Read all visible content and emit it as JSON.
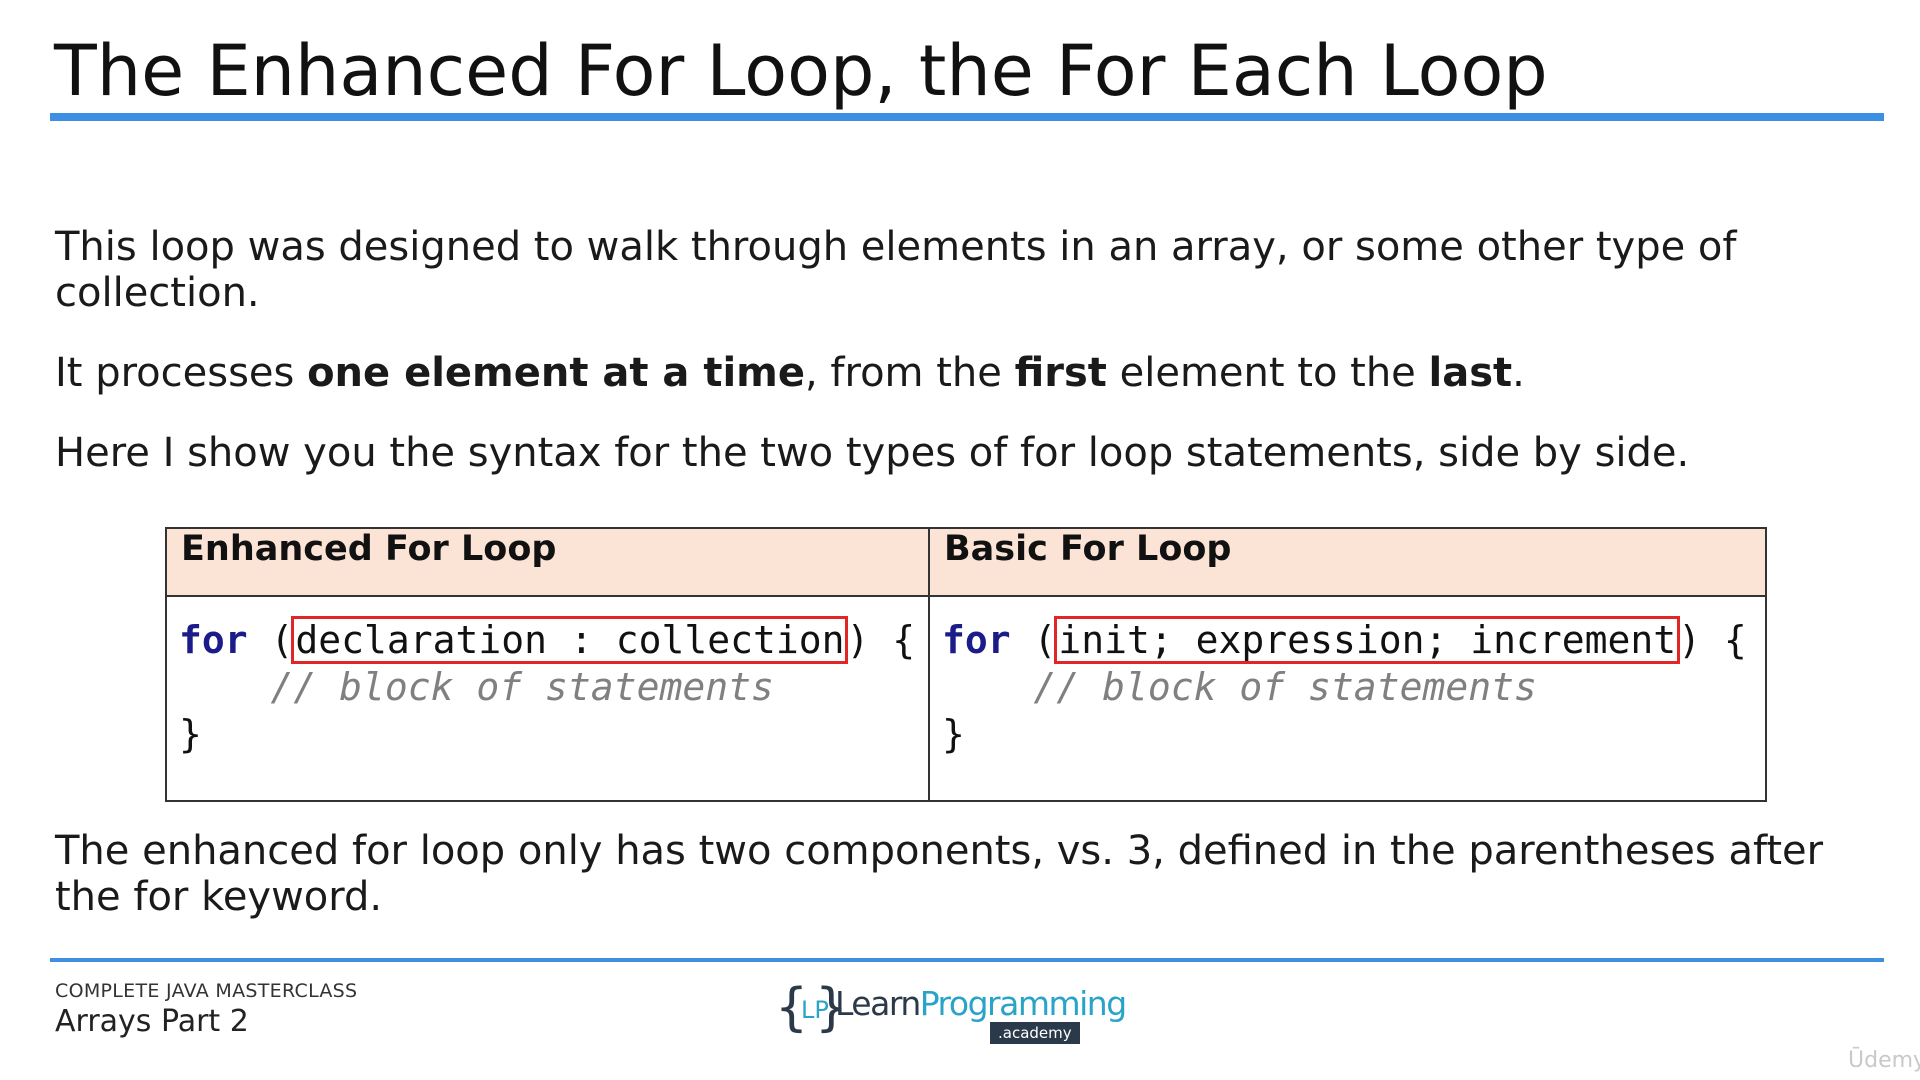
{
  "slide": {
    "title": "The Enhanced For Loop, the For Each Loop",
    "paragraphs": {
      "p1": "This loop was designed to walk through elements in an array, or some other type of collection.",
      "p2_parts": [
        "It processes ",
        "one element at a time",
        ", from the ",
        "first",
        " element to the ",
        "last",
        "."
      ],
      "p3": "Here I show you the syntax for the two types of for loop statements, side by side.",
      "p4": "The enhanced for loop only has two components, vs. 3, defined in the parentheses after the for keyword."
    },
    "table": {
      "headers": [
        "Enhanced For Loop",
        "Basic For Loop"
      ],
      "enhanced": {
        "keyword": "for",
        "open": " (",
        "boxed": "declaration : collection",
        "close": ") {",
        "indent": "    ",
        "comment": "// block of statements",
        "end": "}"
      },
      "basic": {
        "keyword": "for",
        "open": " (",
        "boxed": "init; expression; increment",
        "close": ") {",
        "indent": "    ",
        "comment": "// block of statements",
        "end": "}"
      },
      "colors": {
        "header_bg": "#fbe4d6",
        "highlight_box": "#e02626",
        "keyword": "#1b1b8a",
        "comment": "#808080"
      }
    }
  },
  "footer": {
    "course": "COMPLETE JAVA MASTERCLASS",
    "lesson": "Arrays Part 2",
    "logo": {
      "brace_open": "{",
      "brace_close": "}",
      "initials": "LP",
      "name_a": "Learn",
      "name_b": "Programming",
      "academy": ".academy"
    },
    "watermark": "Ūdemy"
  },
  "colors": {
    "accent_rule": "#3d8fe3"
  }
}
